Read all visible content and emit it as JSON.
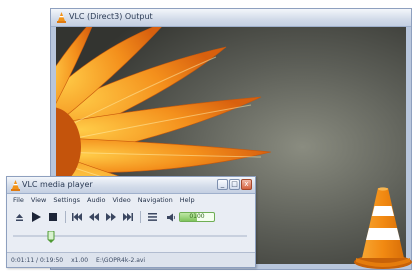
{
  "dx_window": {
    "title": "VLC (Direct3) Output",
    "video_subject": "orange-flower-closeup"
  },
  "vlc_window": {
    "title": "VLC media player",
    "menu": [
      "File",
      "View",
      "Settings",
      "Audio",
      "Video",
      "Navigation",
      "Help"
    ],
    "window_buttons": {
      "minimize": "_",
      "maximize": "□",
      "close": "x"
    },
    "toolbar_icons": [
      "eject-icon",
      "play-icon",
      "stop-icon",
      "previous-icon",
      "rewind-icon",
      "fast-forward-icon",
      "next-icon",
      "playlist-icon"
    ],
    "volume": {
      "label": "0100",
      "level": 0.5
    },
    "seek": {
      "position": 0.15
    },
    "status": {
      "time": "0:01:11 / 0:19:50",
      "speed": "x1.00",
      "info": "E:\\GOPR4k-2.avi"
    }
  },
  "colors": {
    "accent_orange": "#f29318",
    "title_text": "#2b3b55",
    "volume_green": "#7fc45d"
  }
}
